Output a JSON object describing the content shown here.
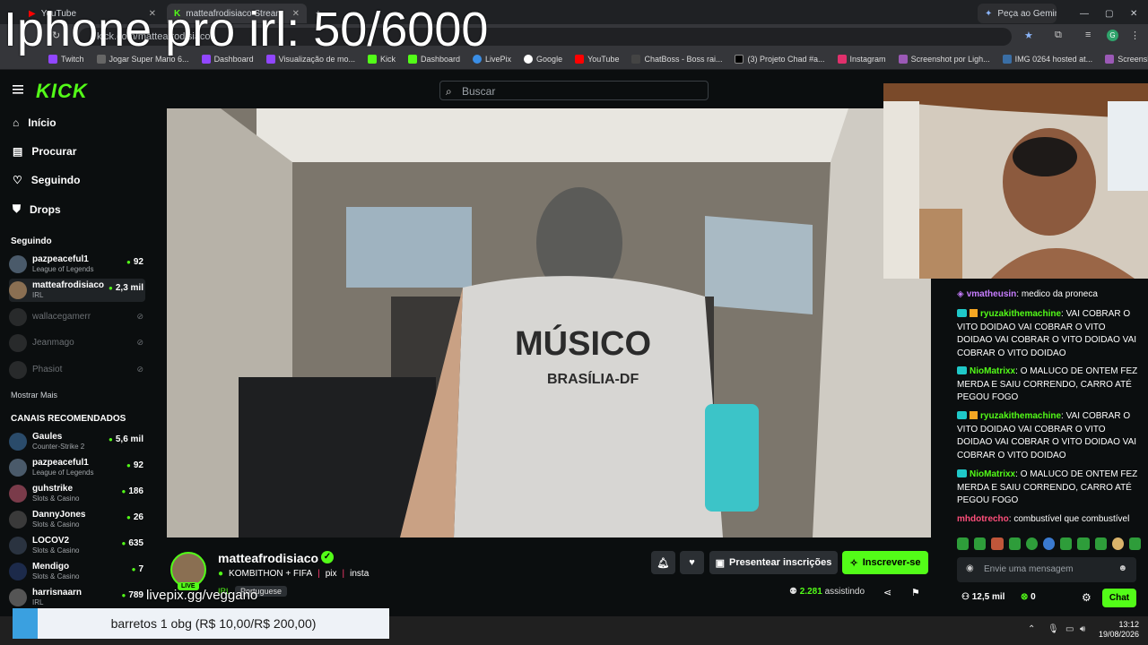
{
  "overlay_title": "Iphone pro irl: 50/6000",
  "browser": {
    "tabs": [
      {
        "label": "YouTube",
        "active": false
      },
      {
        "label": "matteafrodisiaco Stream",
        "active": true
      }
    ],
    "gemini": "Peça ao Gemini",
    "url": "kick.com/matteafrodisiaco",
    "bookmarks": [
      "Twitch",
      "Jogar Super Mario 6...",
      "Dashboard",
      "Visualização de mo...",
      "Kick",
      "Dashboard",
      "LivePix",
      "Google",
      "YouTube",
      "ChatBoss - Boss rai...",
      "(3) Projeto Chad #a...",
      "Instagram",
      "Screenshot por Ligh...",
      "IMG 0264 hosted at...",
      "Screenshot por Ligh..."
    ]
  },
  "site": {
    "logo": "KICK",
    "search_placeholder": "Buscar",
    "nav": [
      "Início",
      "Procurar",
      "Seguindo",
      "Drops"
    ],
    "following_title": "Seguindo",
    "following": [
      {
        "name": "pazpeaceful1",
        "category": "League of Legends",
        "viewers": "92"
      },
      {
        "name": "matteafrodisiaco",
        "category": "IRL",
        "viewers": "2,3 mil"
      },
      {
        "name": "wallacegamerr",
        "offline": true
      },
      {
        "name": "Jeanmago",
        "offline": true
      },
      {
        "name": "Phasiot",
        "offline": true
      }
    ],
    "show_more": "Mostrar Mais",
    "recommended_title": "CANAIS RECOMENDADOS",
    "recommended": [
      {
        "name": "Gaules",
        "category": "Counter-Strike 2",
        "viewers": "5,6 mil"
      },
      {
        "name": "pazpeaceful1",
        "category": "League of Legends",
        "viewers": "92"
      },
      {
        "name": "guhstrike",
        "category": "Slots & Casino",
        "viewers": "186"
      },
      {
        "name": "DannyJones",
        "category": "Slots & Casino",
        "viewers": "26"
      },
      {
        "name": "LOCOV2",
        "category": "Slots & Casino",
        "viewers": "635"
      },
      {
        "name": "Mendigo",
        "category": "Slots & Casino",
        "viewers": "7"
      },
      {
        "name": "harrisnaarn",
        "category": "IRL",
        "viewers": "789"
      }
    ]
  },
  "stream": {
    "streamer": "matteafrodisiaco",
    "live": "LIVE",
    "title": "KOMBITHON + FIFA",
    "title_links": [
      "pix",
      "insta"
    ],
    "category": "IRL",
    "language": "Portuguese",
    "livepix": "livepix.gg/veggano",
    "viewers": "2.281",
    "viewers_label": "assistindo",
    "gift_label": "Presentear inscrições",
    "subscribe_label": "Inscrever-se",
    "shirt_line1": "MÚSICO",
    "shirt_line2": "BRASÍLIA-DF"
  },
  "chat": {
    "messages": [
      {
        "user": "vmatheusin",
        "color": "#c77dff",
        "text": "medico da proneca"
      },
      {
        "user": "ryuzakithemachine",
        "color": "#53fc18",
        "text": "VAI COBRAR O VITO DOIDAO VAI COBRAR O VITO DOIDAO VAI COBRAR O VITO DOIDAO VAI COBRAR O VITO DOIDAO"
      },
      {
        "user": "NioMatrixx",
        "color": "#53fc18",
        "text": "O MALUCO DE ONTEM FEZ MERDA E SAIU CORRENDO, CARRO ATÉ PEGOU FOGO"
      },
      {
        "user": "ryuzakithemachine",
        "color": "#53fc18",
        "text": "VAI COBRAR O VITO DOIDAO VAI COBRAR O VITO DOIDAO VAI COBRAR O VITO DOIDAO VAI COBRAR O VITO DOIDAO"
      },
      {
        "user": "NioMatrixx",
        "color": "#53fc18",
        "text": "O MALUCO DE ONTEM FEZ MERDA E SAIU CORRENDO, CARRO ATÉ PEGOU FOGO"
      },
      {
        "user": "mhdotrecho",
        "color": "#ff4f7b",
        "text": "combustível que combustível"
      }
    ],
    "input_placeholder": "Envie uma mensagem",
    "followers": "12,5 mil",
    "kicks": "0",
    "chat_button": "Chat"
  },
  "donation": "barretos 1 obg (R$ 10,00/R$ 200,00)",
  "taskbar": {
    "time": "13:12",
    "date": "19/08/2026"
  },
  "colors": {
    "accent": "#53fc18",
    "background": "#0b0e0f"
  }
}
